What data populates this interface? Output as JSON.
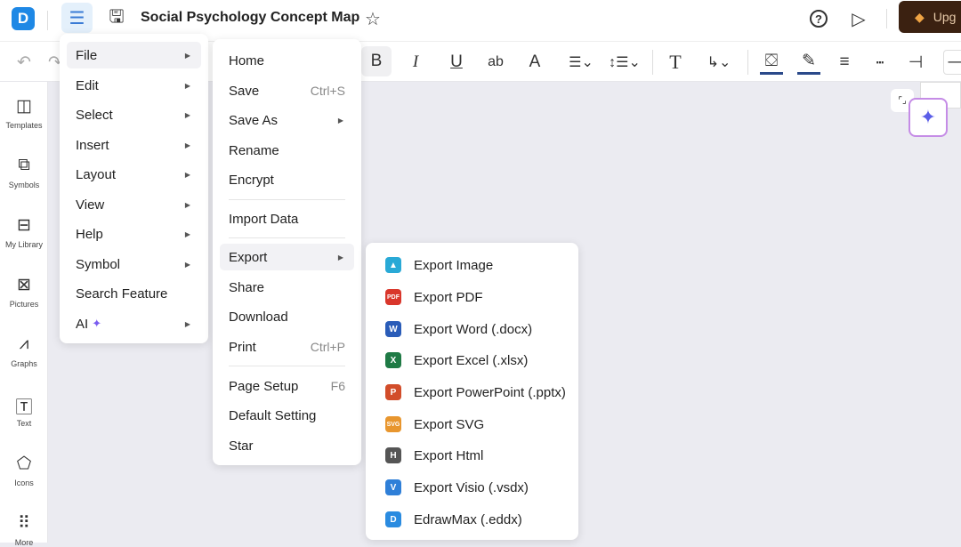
{
  "header": {
    "title": "Social Psychology Concept Map",
    "upgrade_label": "Upg",
    "logo_text": "D"
  },
  "toolbar": {
    "bold": "B",
    "italic": "I",
    "underline": "U",
    "strike": "ab",
    "font_color": "A",
    "text_tool": "T"
  },
  "sidebar": {
    "items": [
      {
        "label": "Templates",
        "icon": "templates-icon"
      },
      {
        "label": "Symbols",
        "icon": "symbols-icon"
      },
      {
        "label": "My Library",
        "icon": "library-icon"
      },
      {
        "label": "Pictures",
        "icon": "pictures-icon"
      },
      {
        "label": "Graphs",
        "icon": "graphs-icon"
      },
      {
        "label": "Text",
        "icon": "text-icon"
      },
      {
        "label": "Icons",
        "icon": "icons-icon"
      },
      {
        "label": "More",
        "icon": "more-icon"
      }
    ]
  },
  "main_menu": {
    "items": [
      {
        "label": "File",
        "submenu": true,
        "active": true
      },
      {
        "label": "Edit",
        "submenu": true
      },
      {
        "label": "Select",
        "submenu": true
      },
      {
        "label": "Insert",
        "submenu": true
      },
      {
        "label": "Layout",
        "submenu": true
      },
      {
        "label": "View",
        "submenu": true
      },
      {
        "label": "Help",
        "submenu": true
      },
      {
        "label": "Symbol",
        "submenu": true
      },
      {
        "label": "Search Feature",
        "submenu": false
      },
      {
        "label": "AI",
        "submenu": true
      }
    ]
  },
  "file_menu": {
    "items": [
      {
        "label": "Home"
      },
      {
        "label": "Save",
        "shortcut": "Ctrl+S"
      },
      {
        "label": "Save As",
        "submenu": true
      },
      {
        "label": "Rename"
      },
      {
        "label": "Encrypt"
      },
      {
        "label": "Import Data"
      },
      {
        "label": "Export",
        "submenu": true,
        "active": true
      },
      {
        "label": "Share"
      },
      {
        "label": "Download"
      },
      {
        "label": "Print",
        "shortcut": "Ctrl+P"
      },
      {
        "label": "Page Setup",
        "shortcut": "F6"
      },
      {
        "label": "Default Setting"
      },
      {
        "label": "Star"
      }
    ]
  },
  "export_menu": {
    "items": [
      {
        "label": "Export Image",
        "badge": "▲",
        "color": "#29a9d6"
      },
      {
        "label": "Export PDF",
        "badge": "PDF",
        "color": "#d9362b"
      },
      {
        "label": "Export Word (.docx)",
        "badge": "W",
        "color": "#2a5cb8"
      },
      {
        "label": "Export Excel (.xlsx)",
        "badge": "X",
        "color": "#1f7a45"
      },
      {
        "label": "Export PowerPoint (.pptx)",
        "badge": "P",
        "color": "#d24d2a"
      },
      {
        "label": "Export SVG",
        "badge": "SVG",
        "color": "#e8962e"
      },
      {
        "label": "Export Html",
        "badge": "H",
        "color": "#555555"
      },
      {
        "label": "Export Visio (.vsdx)",
        "badge": "V",
        "color": "#2f7fd8"
      },
      {
        "label": "EdrawMax (.eddx)",
        "badge": "D",
        "color": "#2a8be0"
      }
    ]
  }
}
